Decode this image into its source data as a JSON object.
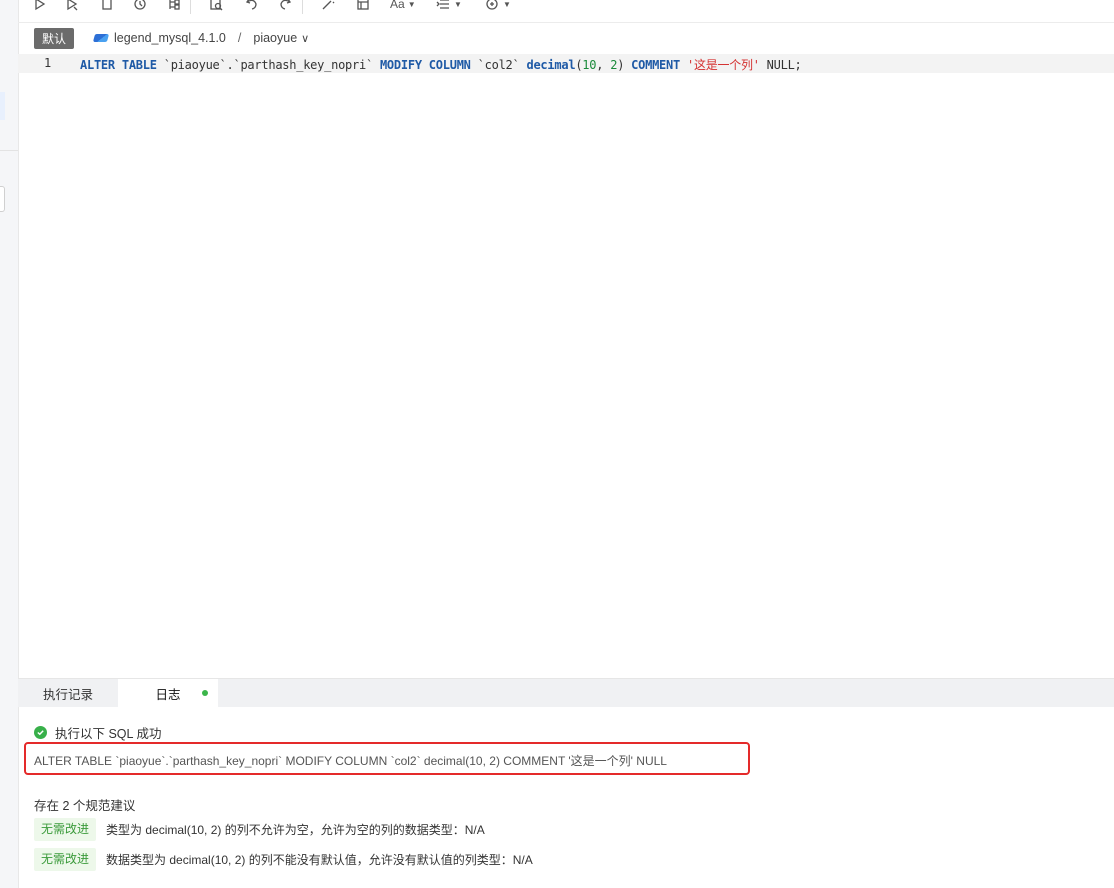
{
  "sidebar": {},
  "toolbar": {
    "icons": [
      "run-icon",
      "run-selected-icon",
      "stop-icon",
      "history-icon",
      "tree-icon",
      "explain-icon",
      "undo-icon",
      "redo-icon",
      "format-magic-icon",
      "table-icon",
      "font-icon",
      "indent-icon",
      "plugin-icon"
    ],
    "font_label": "Aa"
  },
  "breadcrumb": {
    "tag": "默认",
    "datasource": "legend_mysql_4.1.0",
    "separator": "/",
    "schema": "piaoyue"
  },
  "editor": {
    "line_number": "1",
    "tokens": {
      "alter": "ALTER",
      "table": "TABLE",
      "tbl_ident": "`piaoyue`.`parthash_key_nopri`",
      "modify": "MODIFY",
      "column": "COLUMN",
      "col_ident": "`col2`",
      "decimal": "decimal",
      "lparen": "(",
      "n1": "10",
      "comma": ", ",
      "n2": "2",
      "rparen": ")",
      "comment": "COMMENT",
      "comment_str": "'这是一个列'",
      "tail": "NULL;"
    }
  },
  "panel": {
    "tabs": [
      "执行记录",
      "日志"
    ],
    "status": "执行以下 SQL 成功",
    "sql": "ALTER TABLE `piaoyue`.`parthash_key_nopri` MODIFY COLUMN `col2` decimal(10, 2) COMMENT '这是一个列' NULL",
    "suggest_title": "存在 2 个规范建议",
    "suggestions": [
      {
        "badge": "无需改进",
        "text": "类型为 decimal(10, 2) 的列不允许为空，允许为空的列的数据类型：N/A"
      },
      {
        "badge": "无需改进",
        "text": "数据类型为 decimal(10, 2) 的列不能没有默认值，允许没有默认值的列类型：N/A"
      }
    ]
  },
  "colors": {
    "keyword": "#1f5aa6",
    "number": "#1a8a3a",
    "string": "#d43030",
    "success": "#38b04a",
    "highlight_border": "#e42a2a"
  }
}
